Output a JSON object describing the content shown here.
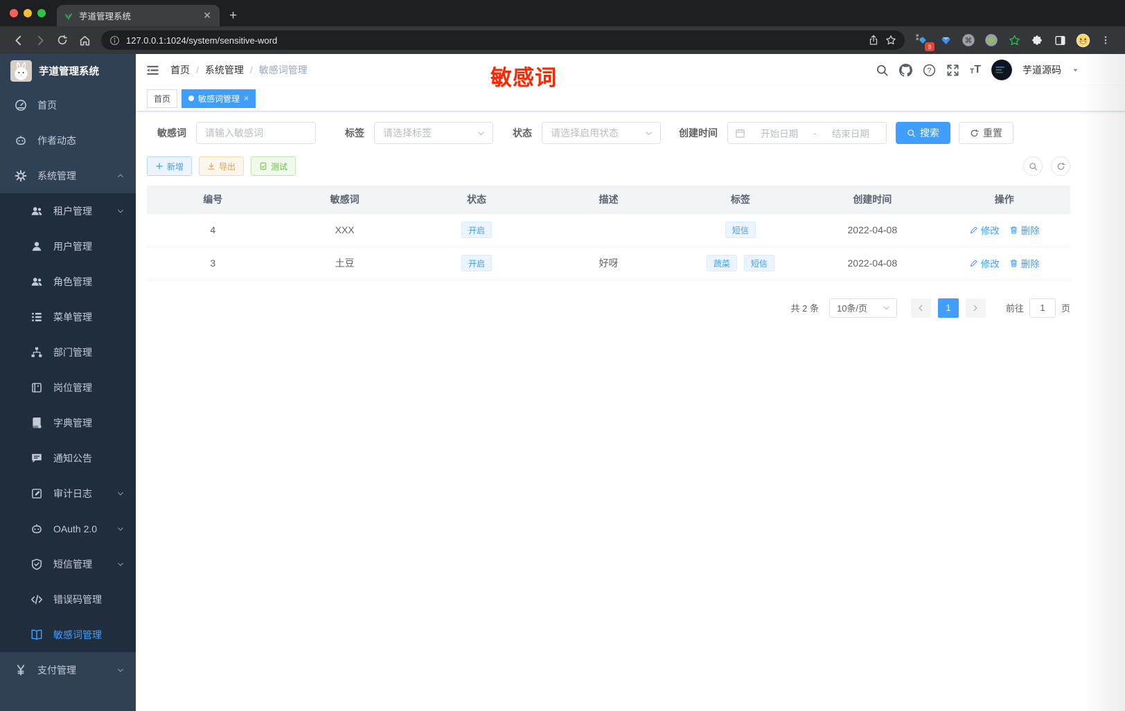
{
  "browser": {
    "tab_title": "芋道管理系统",
    "url": "127.0.0.1:1024/system/sensitive-word",
    "extension_badge": "9"
  },
  "sidebar": {
    "logo_title": "芋道管理系统",
    "items": [
      {
        "label": "首页",
        "icon": "dashboard-icon",
        "level": "top"
      },
      {
        "label": "作者动态",
        "icon": "author-robot-icon",
        "level": "top"
      },
      {
        "label": "系统管理",
        "icon": "gear-icon",
        "level": "top",
        "arrow": "up"
      },
      {
        "label": "租户管理",
        "icon": "tenant-users-icon",
        "level": "sub",
        "arrow": "down"
      },
      {
        "label": "用户管理",
        "icon": "user-icon",
        "level": "sub"
      },
      {
        "label": "角色管理",
        "icon": "role-users-icon",
        "level": "sub"
      },
      {
        "label": "菜单管理",
        "icon": "menu-tree-icon",
        "level": "sub"
      },
      {
        "label": "部门管理",
        "icon": "org-tree-icon",
        "level": "sub"
      },
      {
        "label": "岗位管理",
        "icon": "post-badge-icon",
        "level": "sub"
      },
      {
        "label": "字典管理",
        "icon": "dictionary-book-icon",
        "level": "sub"
      },
      {
        "label": "通知公告",
        "icon": "notice-comment-icon",
        "level": "sub"
      },
      {
        "label": "审计日志",
        "icon": "audit-log-icon",
        "level": "sub",
        "arrow": "down"
      },
      {
        "label": "OAuth 2.0",
        "icon": "oauth-robot-icon",
        "level": "sub",
        "arrow": "down"
      },
      {
        "label": "短信管理",
        "icon": "sms-shield-icon",
        "level": "sub",
        "arrow": "down"
      },
      {
        "label": "错误码管理",
        "icon": "error-code-icon",
        "level": "sub"
      },
      {
        "label": "敏感词管理",
        "icon": "sensitive-word-book-icon",
        "level": "sub",
        "active": true
      },
      {
        "label": "支付管理",
        "icon": "payment-yen-icon",
        "level": "top",
        "arrow": "down"
      }
    ]
  },
  "header": {
    "breadcrumb": [
      "首页",
      "系统管理",
      "敏感词管理"
    ],
    "separator": "/",
    "annotation": "敏感词",
    "username": "芋道源码"
  },
  "tags_view": {
    "tabs": [
      {
        "label": "首页",
        "active": false
      },
      {
        "label": "敏感词管理",
        "active": true
      }
    ]
  },
  "filters": {
    "keyword_label": "敏感词",
    "keyword_placeholder": "请输入敏感词",
    "tag_label": "标签",
    "tag_placeholder": "请选择标签",
    "status_label": "状态",
    "status_placeholder": "请选择启用状态",
    "date_label": "创建时间",
    "date_start_placeholder": "开始日期",
    "date_separator": "-",
    "date_end_placeholder": "结束日期",
    "search_label": "搜索",
    "reset_label": "重置"
  },
  "toolbar": {
    "add_label": "新增",
    "export_label": "导出",
    "test_label": "测试"
  },
  "table": {
    "columns": [
      "编号",
      "敏感词",
      "状态",
      "描述",
      "标签",
      "创建时间",
      "操作"
    ],
    "rows": [
      {
        "id": "4",
        "word": "XXX",
        "status": "开启",
        "description": "",
        "tags": [
          "短信"
        ],
        "created": "2022-04-08"
      },
      {
        "id": "3",
        "word": "土豆",
        "status": "开启",
        "description": "好呀",
        "tags": [
          "蔬菜",
          "短信"
        ],
        "created": "2022-04-08"
      }
    ],
    "edit_label": "修改",
    "delete_label": "删除"
  },
  "pagination": {
    "total_text": "共 2 条",
    "page_size": "10条/页",
    "current_page": "1",
    "goto_label": "前往",
    "goto_value": "1",
    "page_unit": "页"
  },
  "colors": {
    "primary": "#409eff",
    "success": "#67c23a",
    "warning": "#e6a23c",
    "sidebar_bg": "#304156",
    "submenu_bg": "#1f2d3d",
    "annotation_red": "#ff2600",
    "tag_bg": "#ecf5ff",
    "active_tab": "#409eff"
  }
}
